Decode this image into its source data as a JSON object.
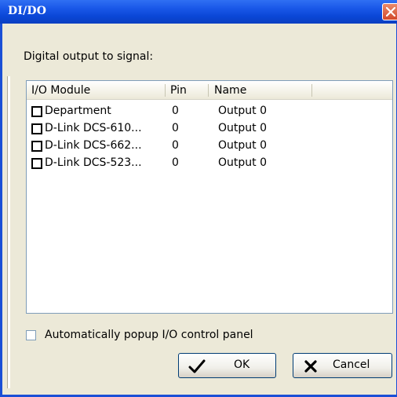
{
  "window": {
    "title": "DI/DO"
  },
  "prompt": "Digital output to signal:",
  "table": {
    "columns": [
      "I/O Module",
      "Pin",
      "Name"
    ],
    "rows": [
      {
        "module": "Department",
        "pin": "0",
        "name": "Output 0"
      },
      {
        "module": "D-Link DCS-610...",
        "pin": "0",
        "name": "Output 0"
      },
      {
        "module": "D-Link DCS-662...",
        "pin": "0",
        "name": "Output 0"
      },
      {
        "module": "D-Link DCS-523...",
        "pin": "0",
        "name": "Output 0"
      }
    ]
  },
  "auto_popup": {
    "label": "Automatically popup I/O control panel",
    "checked": false
  },
  "buttons": {
    "ok": "OK",
    "cancel": "Cancel"
  },
  "icons": {
    "close": "close-icon",
    "ok": "checkmark-icon",
    "cancel": "x-icon"
  },
  "colors": {
    "titlebar": "#0a46d6",
    "close": "#d2492b",
    "border": "#7f9db9"
  }
}
